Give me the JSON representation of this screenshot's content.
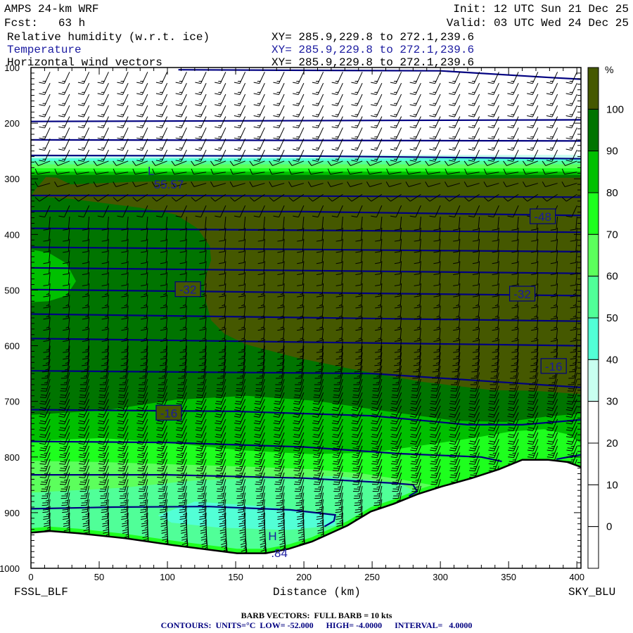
{
  "header": {
    "model": "AMPS 24-km WRF",
    "init": "Init: 12 UTC Sun 21 Dec 25",
    "fcst": "Fcst:   63 h",
    "valid": "Valid: 03 UTC Wed 24 Dec 25",
    "fields": [
      {
        "name": "Relative humidity (w.r.t. ice)",
        "xy": "XY= 285.9,229.8 to 272.1,239.6"
      },
      {
        "name": "Temperature",
        "xy": "XY= 285.9,229.8 to 272.1,239.6"
      },
      {
        "name": "Horizontal wind vectors",
        "xy": "XY= 285.9,229.8 to 272.1,239.6"
      }
    ]
  },
  "footer": {
    "barb_note": "BARB VECTORS:  FULL BARB = 10 kts",
    "contour_note": "CONTOURS:  UNITS=°C  LOW= -52.000      HIGH= -4.0000      INTERVAL=   4.0000"
  },
  "chart_data": {
    "type": "cross-section",
    "xlabel": "Distance (km)",
    "xlim": [
      0,
      403
    ],
    "ylim": [
      1000,
      100
    ],
    "x_ticks": [
      "0",
      "50",
      "100",
      "150",
      "200",
      "250",
      "300",
      "350",
      "400"
    ],
    "y_ticks": [
      "100",
      "200",
      "300",
      "400",
      "500",
      "600",
      "700",
      "800",
      "900",
      "1000"
    ],
    "left_endpoint": "FSSL_BLF",
    "right_endpoint": "SKY_BLU",
    "colorbar": {
      "unit": "%",
      "labels": [
        "100",
        "90",
        "80",
        "70",
        "60",
        "50",
        "40",
        "30",
        "20",
        "10",
        "0"
      ],
      "colors": [
        "#455800",
        "#007400",
        "#00c000",
        "#1eff1e",
        "#5cff5c",
        "#50ff98",
        "#52ffd6",
        "#c8fff0",
        "#ffffff",
        "#ffffff",
        "#ffffff",
        "#ffffff"
      ]
    },
    "contour_color": "#000080",
    "rh_bands_top": {
      "pressures": [
        257,
        263,
        268,
        274,
        281,
        287,
        293
      ],
      "colors": [
        "#c8fff0",
        "#52ffd6",
        "#50ff98",
        "#5cff5c",
        "#1eff1e",
        "#00c000",
        "#007400"
      ]
    },
    "rh_regions": [
      {
        "range": ">100",
        "color": "#455800",
        "points": [
          [
            0,
            331
          ],
          [
            3,
            320
          ],
          [
            11,
            297
          ],
          [
            19,
            298
          ],
          [
            29,
            310
          ],
          [
            80,
            305
          ],
          [
            199,
            302
          ],
          [
            403,
            298
          ],
          [
            403,
            687
          ],
          [
            369,
            681
          ],
          [
            338,
            680
          ],
          [
            287,
            665
          ],
          [
            235,
            642
          ],
          [
            194,
            621
          ],
          [
            158,
            598
          ],
          [
            142,
            579
          ],
          [
            132,
            554
          ],
          [
            127,
            510
          ],
          [
            127,
            484
          ],
          [
            132,
            446
          ],
          [
            131,
            421
          ],
          [
            122,
            389
          ],
          [
            106,
            364
          ],
          [
            80,
            352
          ],
          [
            29,
            336
          ]
        ]
      },
      {
        "range": "80-90",
        "color": "#00c000",
        "points": [
          [
            0,
            427
          ],
          [
            13,
            433
          ],
          [
            26,
            452
          ],
          [
            33,
            484
          ],
          [
            26,
            510
          ],
          [
            13,
            520
          ],
          [
            0,
            522
          ]
        ]
      },
      {
        "range": "80-90",
        "color": "#00c000",
        "points": [
          [
            0,
            724
          ],
          [
            55,
            716
          ],
          [
            106,
            697
          ],
          [
            158,
            690
          ],
          [
            209,
            699
          ],
          [
            261,
            718
          ],
          [
            312,
            735
          ],
          [
            348,
            737
          ],
          [
            379,
            727
          ],
          [
            403,
            722
          ],
          [
            403,
            1000
          ],
          [
            0,
            1000
          ]
        ]
      },
      {
        "range": "70-80",
        "color": "#1eff1e",
        "points": [
          [
            0,
            771
          ],
          [
            52,
            766
          ],
          [
            103,
            775
          ],
          [
            155,
            788
          ],
          [
            206,
            795
          ],
          [
            250,
            792
          ],
          [
            290,
            778
          ],
          [
            326,
            765
          ],
          [
            352,
            754
          ],
          [
            376,
            750
          ],
          [
            393,
            759
          ],
          [
            403,
            775
          ],
          [
            403,
            1000
          ],
          [
            0,
            1000
          ]
        ]
      },
      {
        "range": "60-70",
        "color": "#5cff5c",
        "points": [
          [
            0,
            807
          ],
          [
            52,
            809
          ],
          [
            103,
            813
          ],
          [
            155,
            817
          ],
          [
            206,
            822
          ],
          [
            241,
            829
          ],
          [
            270,
            840
          ],
          [
            300,
            853
          ],
          [
            300,
            1000
          ],
          [
            0,
            1000
          ]
        ]
      },
      {
        "range": "50-60",
        "color": "#50ff98",
        "points": [
          [
            0,
            864
          ],
          [
            69,
            855
          ],
          [
            120,
            842
          ],
          [
            172,
            838
          ],
          [
            223,
            834
          ],
          [
            270,
            847
          ],
          [
            285,
            866
          ],
          [
            285,
            1000
          ],
          [
            0,
            1000
          ]
        ]
      },
      {
        "range": "40-50",
        "color": "#52ffd6",
        "points": [
          [
            93,
            905
          ],
          [
            120,
            880
          ],
          [
            172,
            889
          ],
          [
            223,
            905
          ],
          [
            223,
            923
          ],
          [
            189,
            931
          ],
          [
            138,
            927
          ],
          [
            103,
            918
          ]
        ]
      }
    ],
    "terrain": [
      [
        0,
        936
      ],
      [
        14,
        933
      ],
      [
        35,
        937
      ],
      [
        69,
        946
      ],
      [
        103,
        958
      ],
      [
        151,
        973
      ],
      [
        172,
        973
      ],
      [
        189,
        965
      ],
      [
        206,
        952
      ],
      [
        232,
        923
      ],
      [
        249,
        898
      ],
      [
        266,
        884
      ],
      [
        283,
        867
      ],
      [
        301,
        853
      ],
      [
        323,
        838
      ],
      [
        343,
        822
      ],
      [
        360,
        805
      ],
      [
        379,
        805
      ],
      [
        393,
        809
      ],
      [
        403,
        818
      ]
    ],
    "isotherms": [
      {
        "value": -40,
        "points": [
          [
            108,
            104
          ],
          [
            300,
            106
          ],
          [
            380,
            118
          ],
          [
            403,
            121
          ]
        ]
      },
      {
        "value": -44,
        "points": [
          [
            0,
            197
          ],
          [
            403,
            194
          ]
        ]
      },
      {
        "value": -48,
        "points": [
          [
            0,
            230
          ],
          [
            403,
            232
          ]
        ]
      },
      {
        "value": -52,
        "points": [
          [
            0,
            258
          ],
          [
            200,
            259
          ],
          [
            403,
            264
          ]
        ]
      },
      {
        "value": -52,
        "points": [
          [
            0,
            330
          ],
          [
            100,
            330
          ],
          [
            403,
            333
          ]
        ]
      },
      {
        "value": -48,
        "points": [
          [
            0,
            358
          ],
          [
            200,
            359
          ],
          [
            403,
            366
          ]
        ]
      },
      {
        "value": -44,
        "points": [
          [
            0,
            389
          ],
          [
            403,
            396
          ]
        ]
      },
      {
        "value": -40,
        "points": [
          [
            0,
            423
          ],
          [
            403,
            431
          ]
        ]
      },
      {
        "value": -36,
        "points": [
          [
            0,
            460
          ],
          [
            403,
            470
          ]
        ]
      },
      {
        "value": -32,
        "points": [
          [
            0,
            499
          ],
          [
            403,
            510
          ]
        ]
      },
      {
        "value": -28,
        "points": [
          [
            0,
            543
          ],
          [
            403,
            556
          ]
        ]
      },
      {
        "value": -24,
        "points": [
          [
            0,
            587
          ],
          [
            403,
            600
          ]
        ]
      },
      {
        "value": -20,
        "points": [
          [
            0,
            645
          ],
          [
            250,
            650
          ],
          [
            403,
            675
          ]
        ]
      },
      {
        "value": -16,
        "points": [
          [
            0,
            715
          ],
          [
            150,
            718
          ],
          [
            250,
            726
          ],
          [
            320,
            742
          ],
          [
            360,
            742
          ],
          [
            403,
            733
          ]
        ]
      },
      {
        "value": -12,
        "points": [
          [
            0,
            772
          ],
          [
            100,
            774
          ],
          [
            200,
            782
          ],
          [
            270,
            794
          ],
          [
            330,
            800
          ],
          [
            345,
            808
          ]
        ]
      },
      {
        "value": -12,
        "points": [
          [
            385,
            804
          ],
          [
            403,
            796
          ]
        ]
      },
      {
        "value": -8,
        "points": [
          [
            0,
            832
          ],
          [
            100,
            832
          ],
          [
            200,
            838
          ],
          [
            266,
            847
          ],
          [
            280,
            850
          ],
          [
            283,
            862
          ],
          [
            277,
            870
          ]
        ]
      },
      {
        "value": -4,
        "points": [
          [
            0,
            893
          ],
          [
            60,
            890
          ],
          [
            130,
            889
          ],
          [
            190,
            895
          ],
          [
            223,
            904
          ],
          [
            222,
            915
          ],
          [
            215,
            925
          ]
        ]
      }
    ],
    "contour_labels": [
      {
        "text": "-48",
        "km": 375,
        "p": 368,
        "boxed": true
      },
      {
        "text": "-32",
        "km": 115,
        "p": 499,
        "boxed": true
      },
      {
        "text": "-32",
        "km": 360,
        "p": 507,
        "boxed": true
      },
      {
        "text": "-16",
        "km": 101,
        "p": 721,
        "boxed": true
      },
      {
        "text": "-16",
        "km": 383,
        "p": 637,
        "boxed": true
      },
      {
        "text": "L",
        "km": 88,
        "p": 285,
        "boxed": false
      },
      {
        "text": "55.57",
        "km": 101,
        "p": 310,
        "boxed": false
      },
      {
        "text": "H",
        "km": 177,
        "p": 942,
        "boxed": false
      },
      {
        "text": ".84",
        "km": 182,
        "p": 972,
        "boxed": false
      }
    ],
    "wind_profile": [
      {
        "p": 110,
        "dir": 205,
        "kt": 15
      },
      {
        "p": 250,
        "dir": 205,
        "kt": 15
      },
      {
        "p": 275,
        "dir": 265,
        "kt": 10
      },
      {
        "p": 320,
        "dir": 250,
        "kt": 10
      },
      {
        "p": 360,
        "dir": 185,
        "kt": 10
      },
      {
        "p": 600,
        "dir": 185,
        "kt": 15
      },
      {
        "p": 700,
        "dir": 205,
        "kt": 20
      },
      {
        "p": 820,
        "dir": 200,
        "kt": 25
      },
      {
        "p": 960,
        "dir": 170,
        "kt": 25
      }
    ]
  }
}
